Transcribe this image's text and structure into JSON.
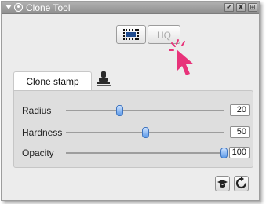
{
  "window": {
    "title": "Clone Tool",
    "title_buttons": [
      "✔",
      "✘",
      "⊞"
    ]
  },
  "mode_buttons": {
    "selection_icon": "selection-rectangle-icon",
    "hq_label": "HQ"
  },
  "tabs": {
    "clone_stamp_label": "Clone stamp",
    "stamp_icon": "stamp-icon"
  },
  "sliders": [
    {
      "label": "Radius",
      "value": "20",
      "fraction": 0.34
    },
    {
      "label": "Hardness",
      "value": "50",
      "fraction": 0.5
    },
    {
      "label": "Opacity",
      "value": "100",
      "fraction": 1.0
    }
  ],
  "bottom_buttons": [
    "presets-icon",
    "reset-icon"
  ],
  "colors": {
    "accent": "#5a98e8",
    "cursor": "#e8337a"
  }
}
